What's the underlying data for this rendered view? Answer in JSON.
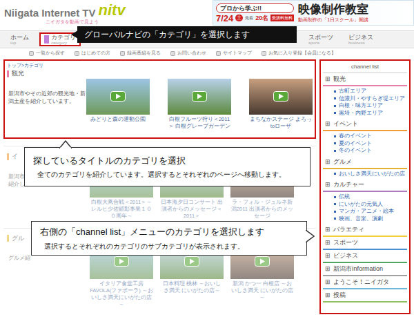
{
  "header": {
    "logo_text": "Niigata Internet TV",
    "logo_mark": "nitv",
    "tagline": "ニイガタを動画で見よう",
    "banner": {
      "lead": "プロから学ぶ!!",
      "date": "7/24",
      "day": "土",
      "capacity_label": "先着",
      "capacity": "20名",
      "fee": "受講料無料",
      "title": "映像制作教室",
      "sub": "動画制作の「1日スクール」開講"
    }
  },
  "nav": [
    {
      "label": "ホーム",
      "sub": "top",
      "selected": false
    },
    {
      "label": "カテゴリ",
      "sub": "category",
      "selected": true
    },
    {
      "label": "スポーツ",
      "sub": "sports",
      "selected": false
    },
    {
      "label": "ビジネス",
      "sub": "business",
      "selected": false
    }
  ],
  "subnav": [
    "一覧から探す",
    "はじめての方",
    "録画番組を見る",
    "お問い合わせ",
    "サイトマップ",
    "お気に入り登録【会員になる】"
  ],
  "breadcrumb": "トップ>カテゴリ",
  "categories": [
    {
      "name": "観光",
      "color": "#e87fa8",
      "highlighted": true,
      "dimmed": false,
      "description": [
        "新潟市やその近郊の観光地・新",
        "潟土産を紹介しています。"
      ],
      "videos": [
        "みどりと森の運動公園",
        "白根フルーツ狩り＜2011＞ 白根グレープガーデン",
        "まちなかステージ よろっtoローザ"
      ]
    },
    {
      "name": "イ",
      "color": "#f29c38",
      "highlighted": false,
      "dimmed": true,
      "description": [
        "新潟市",
        "紹介し"
      ],
      "videos": [
        "白根大凧合戦＜2011＞～レルヒ少佐顕彰事業１００周年～",
        "日本海夕日コンサート 出演者からのメッセージ＜2011＞",
        "ラ・フォル・ジュルネ新潟2011 出演者からのメッセージ"
      ]
    },
    {
      "name": "グル",
      "color": "#e8c040",
      "highlighted": false,
      "dimmed": true,
      "description": [
        "グルメ紹"
      ],
      "videos": [
        "イタリア食堂工房FAVOLA(ファボーラ) ～おいしさ満天にいがたの店～",
        "日本料理 桃林 ～おいしさ満天 にいがたの店～",
        "新潟 かつ一 白根店 ～おいしさ満天 にいがたの店～"
      ]
    }
  ],
  "sidebar": {
    "title": "channel list",
    "icon": "⊞",
    "highlighted": true,
    "items": [
      {
        "label": "観光",
        "color": "#e87fa8",
        "subitems": [
          "古町エリア",
          "信濃川・やすらぎ堤エリア",
          "白根・味方エリア",
          "黒埼・内野エリア"
        ]
      },
      {
        "label": "イベント",
        "color": "#f29c38",
        "subitems": [
          "春のイベント",
          "夏のイベント",
          "冬のイベント"
        ]
      },
      {
        "label": "グルメ",
        "color": "#e8b030",
        "subitems": [
          "おいしさ満天にいがたの店"
        ]
      },
      {
        "label": "カルチャー",
        "color": "#b07cc0",
        "subitems": [
          "伝統",
          "にいがたの元気人",
          "マンガ・アニメ・絵本",
          "映画、音楽、演劇"
        ]
      },
      {
        "label": "バラエティ",
        "color": "#f0d040",
        "subitems": []
      },
      {
        "label": "スポーツ",
        "color": "#4a90d0",
        "subitems": []
      },
      {
        "label": "ビジネス",
        "color": "#50a860",
        "subitems": []
      },
      {
        "label": "新潟市Information",
        "color": "#a0a0a0",
        "subitems": []
      },
      {
        "label": "ようこそ！ニイガタ",
        "color": "#70b8d8",
        "subitems": []
      },
      {
        "label": "投稿",
        "color": "#90c060",
        "subitems": []
      }
    ]
  },
  "annotations": [
    {
      "kind": "dark",
      "title": "グローバルナビの「カテゴリ」を選択します",
      "text": ""
    },
    {
      "kind": "light",
      "title": "探しているタイトルのカテゴリを選択",
      "text": "全てのカテゴリを紹介しています。選択するとそれぞれのページへ移動します。"
    },
    {
      "kind": "light",
      "title": "右側の「channel list」メニューのカテゴリを選択します",
      "text": "選択するとそれぞれのカテゴリのサブカテゴリが表示されます。"
    }
  ]
}
